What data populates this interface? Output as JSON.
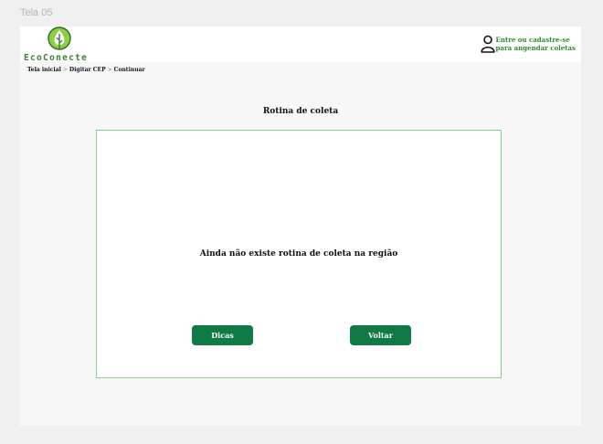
{
  "frame_label": "Tela 05",
  "brand": {
    "name": "EcoConecte",
    "color": "#3f7d3a"
  },
  "account": {
    "line1": "Entre ou cadastre-se",
    "line2": "para angendar coletas",
    "icon": "user-icon"
  },
  "breadcrumb": {
    "items": [
      "Tela inicial",
      "Digitar CEP",
      "Continuar"
    ],
    "separator": ">"
  },
  "main": {
    "title": "Rotina de coleta",
    "message": "Ainda não existe  rotina de coleta na região",
    "buttons": {
      "tips": "Dicas",
      "back": "Voltar"
    }
  },
  "colors": {
    "accent": "#0f7a45",
    "card_border": "#7fd18f",
    "link": "#2e8b2e"
  }
}
